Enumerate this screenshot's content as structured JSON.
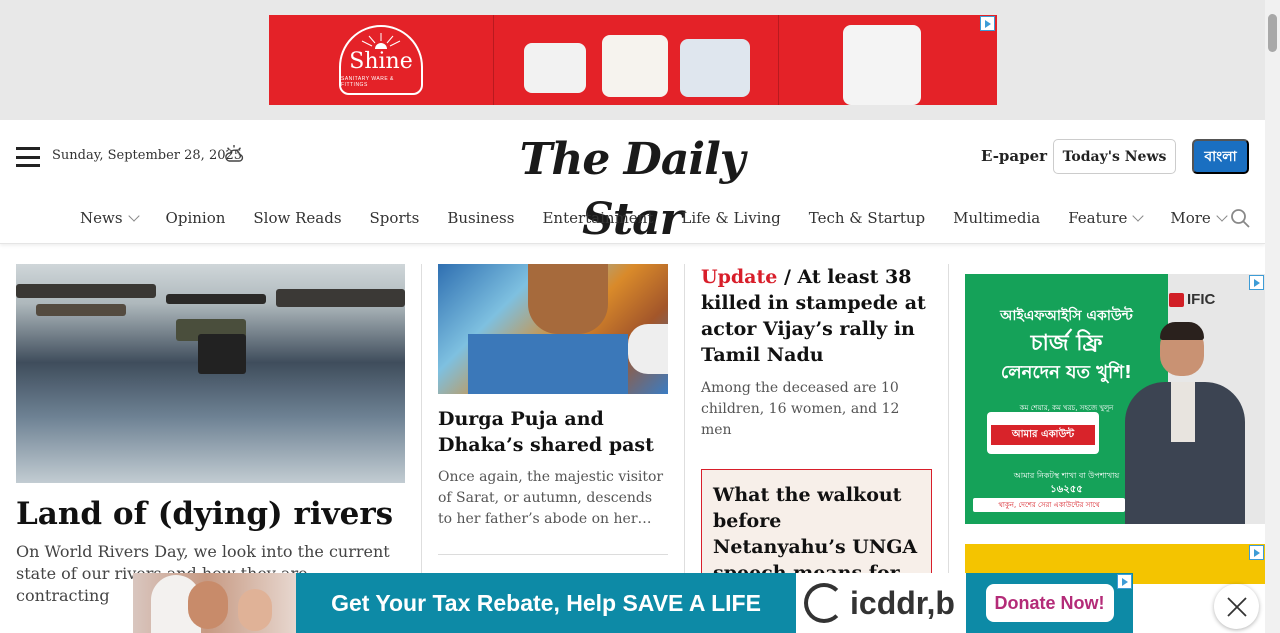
{
  "top_ad": {
    "brand": "Shine",
    "tagline": "SANITARY WARE & FITTINGS"
  },
  "header": {
    "date": "Sunday, September 28, 2025",
    "logo_text": "The Daily Star",
    "epaper_label": "E-paper",
    "todays_news_label": "Today's News",
    "bangla_label": "বাংলা"
  },
  "nav": {
    "items": [
      {
        "label": "News",
        "dropdown": true
      },
      {
        "label": "Opinion",
        "dropdown": false
      },
      {
        "label": "Slow Reads",
        "dropdown": false
      },
      {
        "label": "Sports",
        "dropdown": false
      },
      {
        "label": "Business",
        "dropdown": false
      },
      {
        "label": "Entertainment",
        "dropdown": false
      },
      {
        "label": "Life & Living",
        "dropdown": false
      },
      {
        "label": "Tech & Startup",
        "dropdown": false
      },
      {
        "label": "Multimedia",
        "dropdown": false
      },
      {
        "label": "Feature",
        "dropdown": true
      },
      {
        "label": "More",
        "dropdown": true
      }
    ]
  },
  "articles": {
    "lead": {
      "title": "Land of (dying) rivers",
      "summary": "On World Rivers Day, we look into the current state of our rivers and how they are contracting"
    },
    "second": {
      "title": "Durga Puja and Dhaka’s shared past",
      "summary": "Once again, the majestic visitor of Sarat, or autumn, descends to her father’s abode on her…"
    },
    "third": {
      "tag": "Update",
      "separator": " / ",
      "title": "At least 38 killed in stampede at actor Vijay’s rally in Tamil Nadu",
      "summary": "Among the deceased are 10 children, 16 women, and 12 men"
    },
    "boxed": {
      "title": "What the walkout before Netanyahu’s UNGA speech means for Israel"
    }
  },
  "side_ad": {
    "brand": "IFIC",
    "line1": "আইএফআইসি একাউন্ট",
    "line2": "চার্জ ফ্রি",
    "line3": "লেনদেন যত খুশি!",
    "small": "কম শেয়ার, কম খরচ, সহজে খুলুন",
    "card_text": "আমার একাউন্ট",
    "hotline_label": "আমার নিকটস্থ শাখা বা উপশাখায়",
    "hotline": "১৬২৫৫",
    "footer": "থাকুন, দেশের সেরা একাউন্টের সাথে"
  },
  "bottom_ad": {
    "headline": "Get Your Tax Rebate, Help SAVE A LIFE",
    "brand": "icddr,b",
    "cta": "Donate Now!"
  },
  "colors": {
    "accent_red": "#d81e2a",
    "bangla_blue": "#1a6fc1",
    "ad_red": "#e42228",
    "ific_green": "#15a259",
    "icddr_teal": "#0d8aa6"
  }
}
